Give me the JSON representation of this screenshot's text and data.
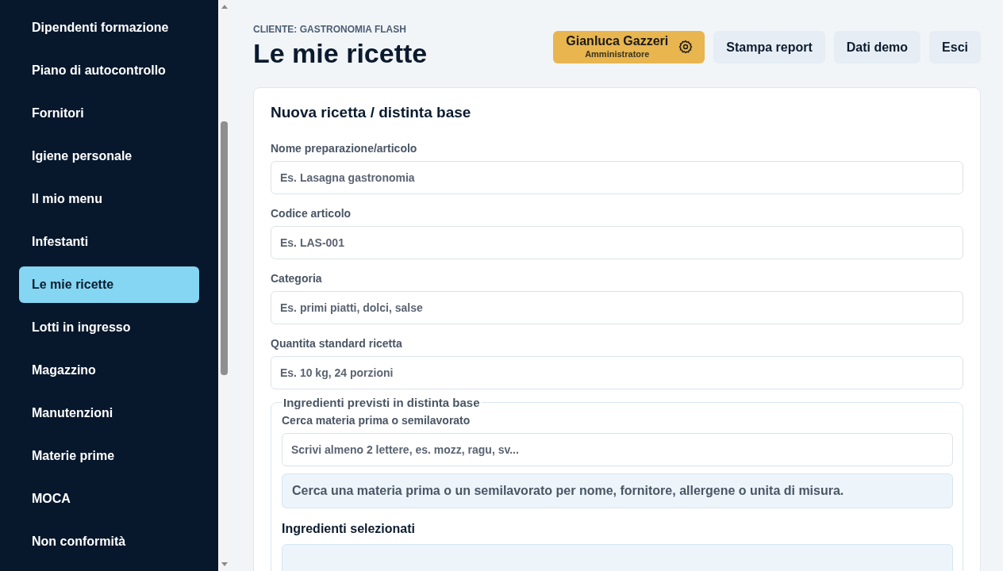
{
  "sidebar": {
    "items": [
      {
        "label": "Dipendenti formazione",
        "selected": false
      },
      {
        "label": "Piano di autocontrollo",
        "selected": false
      },
      {
        "label": "Fornitori",
        "selected": false
      },
      {
        "label": "Igiene personale",
        "selected": false
      },
      {
        "label": "Il mio menu",
        "selected": false
      },
      {
        "label": "Infestanti",
        "selected": false
      },
      {
        "label": "Le mie ricette",
        "selected": true
      },
      {
        "label": "Lotti in ingresso",
        "selected": false
      },
      {
        "label": "Magazzino",
        "selected": false
      },
      {
        "label": "Manutenzioni",
        "selected": false
      },
      {
        "label": "Materie prime",
        "selected": false
      },
      {
        "label": "MOCA",
        "selected": false
      },
      {
        "label": "Non conformità",
        "selected": false
      }
    ]
  },
  "header": {
    "client": "CLIENTE: GASTRONOMIA FLASH",
    "title": "Le mie ricette",
    "user": {
      "name": "Gianluca Gazzeri",
      "role": "Amministratore"
    },
    "buttons": [
      "Stampa report",
      "Dati demo",
      "Esci"
    ]
  },
  "form": {
    "title": "Nuova ricetta / distinta base",
    "fields": [
      {
        "label": "Nome preparazione/articolo",
        "placeholder": "Es. Lasagna gastronomia"
      },
      {
        "label": "Codice articolo",
        "placeholder": "Es. LAS-001"
      },
      {
        "label": "Categoria",
        "placeholder": "Es. primi piatti, dolci, salse"
      },
      {
        "label": "Quantita standard ricetta",
        "placeholder": "Es. 10 kg, 24 porzioni"
      }
    ],
    "ingredients": {
      "legend": "Ingredienti previsti in distinta base",
      "search_label": "Cerca materia prima o semilavorato",
      "search_placeholder": "Scrivi almeno 2 lettere, es. mozz, ragu, sv...",
      "hint": "Cerca una materia prima o un semilavorato per nome, fornitore, allergene o unita di misura.",
      "selected_title": "Ingredienti selezionati"
    }
  }
}
